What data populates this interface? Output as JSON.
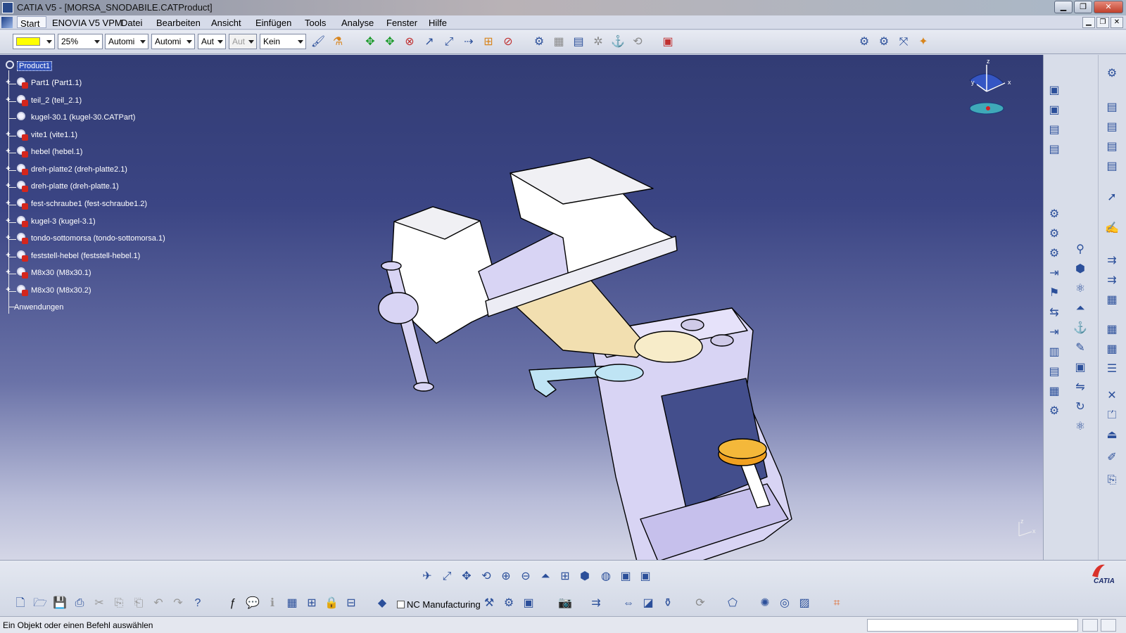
{
  "window": {
    "title": "CATIA V5 - [MORSA_SNODABILE.CATProduct]",
    "minimize": "▁",
    "maximize": "❐",
    "close": "✕"
  },
  "menu": {
    "items": [
      "Start",
      "ENOVIA V5 VPM",
      "Datei",
      "Bearbeiten",
      "Ansicht",
      "Einfügen",
      "Tools",
      "Analyse",
      "Fenster",
      "Hilfe"
    ],
    "mdi": [
      "▁",
      "❐",
      "✕"
    ]
  },
  "toolbar_top": {
    "color_value": "",
    "transparency_value": "25%",
    "linetype_value": "Automi",
    "thickness_value": "Automi",
    "point_value": "Aut",
    "layer_value": "Aut",
    "render_value": "Kein"
  },
  "spec_tree": {
    "root": "Product1",
    "items": [
      "Part1 (Part1.1)",
      "teil_2 (teil_2.1)",
      "kugel-30.1 (kugel-30.CATPart)",
      "vite1 (vite1.1)",
      "hebel (hebel.1)",
      "dreh-platte2 (dreh-platte2.1)",
      "dreh-platte (dreh-platte.1)",
      "fest-schraube1 (fest-schraube1.2)",
      "kugel-3 (kugel-3.1)",
      "tondo-sottomorsa (tondo-sottomorsa.1)",
      "feststell-hebel (feststell-hebel.1)",
      "M8x30 (M8x30.1)",
      "M8x30 (M8x30.2)"
    ],
    "applications": "Anwendungen"
  },
  "compass": {
    "axis_x": "x",
    "axis_y": "y",
    "axis_z": "z"
  },
  "mini_axes": {
    "axis_x": "x",
    "axis_z": "z"
  },
  "bottom_toolbar": {
    "workbench_label": "NC Manufacturing",
    "brand": "CATIA"
  },
  "status": {
    "message": "Ein Objekt oder einen Befehl auswählen"
  },
  "colors": {
    "viewport_top": "#323c74",
    "viewport_bottom": "#d4d6e6",
    "part_lavender": "#d8d4f4",
    "part_cream": "#f2dfb0",
    "knob_orange": "#f0a020",
    "knob_red": "#e01010",
    "lever_cyan": "#bfe4f4"
  }
}
